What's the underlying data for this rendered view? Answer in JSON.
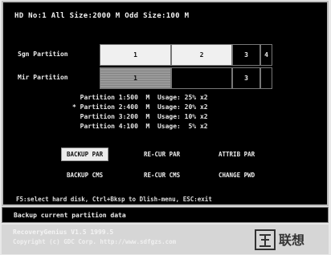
{
  "header": {
    "text": "HD No:1  All Size:2000 M  Odd Size:100 M"
  },
  "sgn": {
    "label": "Sgn Partition",
    "segments": [
      "1",
      "2",
      "3",
      "4"
    ]
  },
  "mir": {
    "label": "Mir Partition",
    "segments": [
      "1",
      "3"
    ]
  },
  "partitions": [
    "  Partition 1:500  M  Usage: 25% x2",
    "* Partition 2:400  M  Usage: 20% x2",
    "  Partition 3:200  M  Usage: 10% x2",
    "  Partition 4:100  M  Usage:  5% x2"
  ],
  "buttons": {
    "backup_part": "BACKUP PAR",
    "recur_part": "RE-CUR PAR",
    "attrib_part": "ATTRIB PAR",
    "backup_cmos": "BACKUP CMS",
    "recur_cmos": "RE-CUR CMS",
    "change_pwd": "CHANGE PWD"
  },
  "hint": "F5:select hard disk, Ctrl+Bksp to Dlish-menu, ESC:exit",
  "status": "Backup current partition data",
  "footer": {
    "line1": "RecoveryGenius V1.5     1999.5",
    "line2": "Copyright (c) GDC Corp. http://www.sdfgzs.com"
  },
  "logo_text": "联想",
  "colors": {
    "background": "#000000",
    "bar_light": "#f0f0f0",
    "bar_used": "#9a9a9a",
    "footer": "#d6d6d6"
  }
}
